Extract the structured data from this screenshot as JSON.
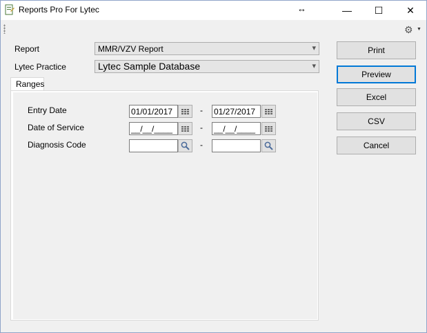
{
  "window": {
    "title": "Reports Pro For Lytec"
  },
  "titlebar": {
    "minimize": "—",
    "maximize": "☐",
    "close": "✕",
    "resize_cursor": "↔"
  },
  "toolbar": {
    "settings_icon": "⚙",
    "settings_caret": "▼"
  },
  "form": {
    "report_label": "Report",
    "report_value": "MMR/VZV Report",
    "practice_label": "Lytec Practice",
    "practice_value": "Lytec Sample Database"
  },
  "tabs": [
    {
      "label": "Ranges"
    }
  ],
  "ranges": {
    "entry_date": {
      "label": "Entry Date",
      "from": "01/01/2017",
      "to": "01/27/2017",
      "dash": "-"
    },
    "date_of_service": {
      "label": "Date of Service",
      "from": "__/__/____",
      "to": "__/__/____",
      "dash": "-"
    },
    "diagnosis_code": {
      "label": "Diagnosis Code",
      "from": "",
      "to": "",
      "dash": "-"
    }
  },
  "buttons": {
    "print": "Print",
    "preview": "Preview",
    "excel": "Excel",
    "csv": "CSV",
    "cancel": "Cancel"
  },
  "icons": {
    "calendar": "calendar-icon",
    "search": "search-icon",
    "dropdown": "▾",
    "search_glyph": "🔍"
  }
}
